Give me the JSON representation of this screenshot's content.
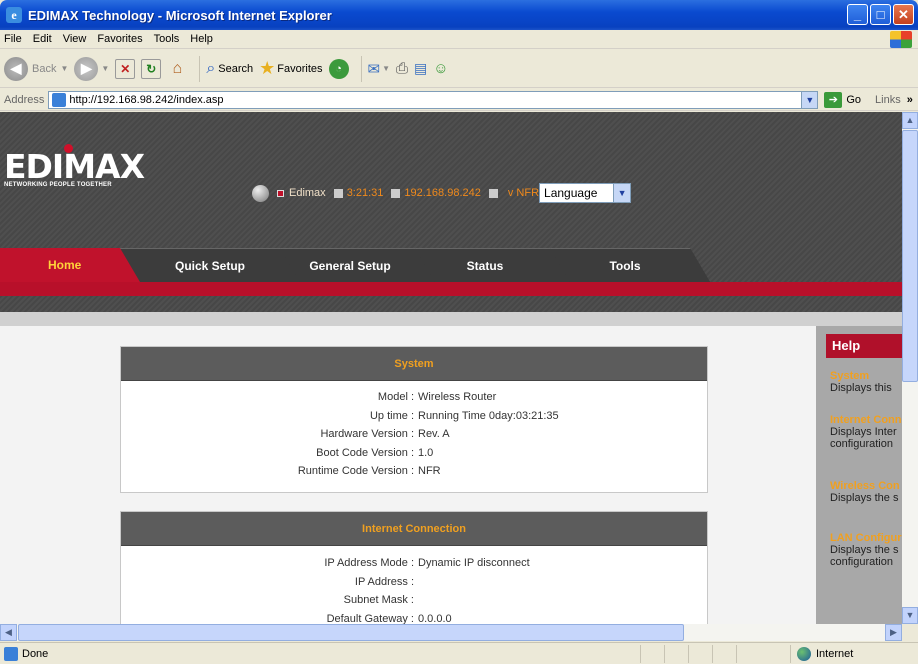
{
  "window": {
    "title": "EDIMAX Technology - Microsoft Internet Explorer"
  },
  "menu": [
    "File",
    "Edit",
    "View",
    "Favorites",
    "Tools",
    "Help"
  ],
  "toolbar": {
    "back": "Back",
    "search": "Search",
    "favorites": "Favorites"
  },
  "address": {
    "label": "Address",
    "url": "http://192.168.98.242/index.asp",
    "go": "Go",
    "links": "Links"
  },
  "page": {
    "logo": {
      "text": "EDIMAX",
      "tagline": "NETWORKING PEOPLE TOGETHER"
    },
    "infoline": {
      "name": "Edimax",
      "time": "3:21:31",
      "ip": "192.168.98.242",
      "version": "v NFR",
      "language": "Language"
    },
    "tabs": [
      "Home",
      "Quick Setup",
      "General Setup",
      "Status",
      "Tools"
    ],
    "system": {
      "title": "System",
      "rows": [
        {
          "k": "Model :",
          "v": "Wireless Router"
        },
        {
          "k": "Up time :",
          "v": "Running Time 0day:03:21:35"
        },
        {
          "k": "Hardware Version :",
          "v": "Rev. A"
        },
        {
          "k": "Boot Code Version :",
          "v": "1.0"
        },
        {
          "k": "Runtime Code Version :",
          "v": "NFR"
        }
      ]
    },
    "internet": {
      "title": "Internet Connection",
      "rows": [
        {
          "k": "IP Address Mode :",
          "v": "Dynamic IP disconnect"
        },
        {
          "k": "IP Address :",
          "v": ""
        },
        {
          "k": "Subnet Mask :",
          "v": ""
        },
        {
          "k": "Default Gateway :",
          "v": "0.0.0.0"
        }
      ]
    },
    "help": {
      "title": "Help",
      "items": [
        {
          "t": "System",
          "d1": "Displays this",
          "d2": ""
        },
        {
          "t": "Internet Conn",
          "d1": "Displays Inter",
          "d2": "configuration"
        },
        {
          "t": "Wireless Con",
          "d1": "Displays the s",
          "d2": ""
        },
        {
          "t": "LAN Configur",
          "d1": "Displays the s",
          "d2": "configuration"
        }
      ]
    }
  },
  "status": {
    "text": "Done",
    "zone": "Internet"
  }
}
